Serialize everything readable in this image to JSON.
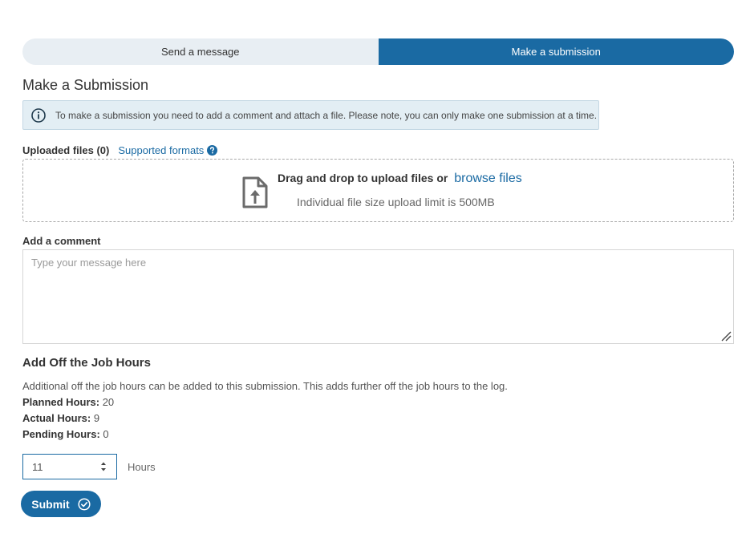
{
  "tabs": [
    {
      "label": "Send a message",
      "active": false
    },
    {
      "label": "Make a submission",
      "active": true
    }
  ],
  "title": "Make a Submission",
  "info": {
    "icon": "info-icon",
    "text": "To make a submission you need to add a comment and attach a file. Please note, you can only make one submission at a time."
  },
  "upload": {
    "files_label": "Uploaded files (0)",
    "formats_link": "Supported formats",
    "help_icon": "question-circle-icon",
    "file_icon": "file-upload-icon",
    "drop_text": "Drag and drop to upload files or",
    "browse_label": "browse files",
    "limit_text": "Individual file size upload limit is 500MB"
  },
  "comment": {
    "label": "Add a comment",
    "placeholder": "Type your message here",
    "value": ""
  },
  "hours": {
    "title": "Add Off the Job Hours",
    "description": "Additional off the job hours can be added to this submission. This adds further off the job hours to the log.",
    "planned_label": "Planned Hours:",
    "planned_value": "20",
    "actual_label": "Actual Hours:",
    "actual_value": "9",
    "pending_label": "Pending Hours:",
    "pending_value": "0",
    "input_value": "11",
    "unit": "Hours"
  },
  "submit": {
    "label": "Submit",
    "icon": "check-circle-icon"
  },
  "colors": {
    "accent": "#1a6aa3",
    "tab_inactive": "#e8eef3",
    "info_bg": "#e3eef4"
  }
}
